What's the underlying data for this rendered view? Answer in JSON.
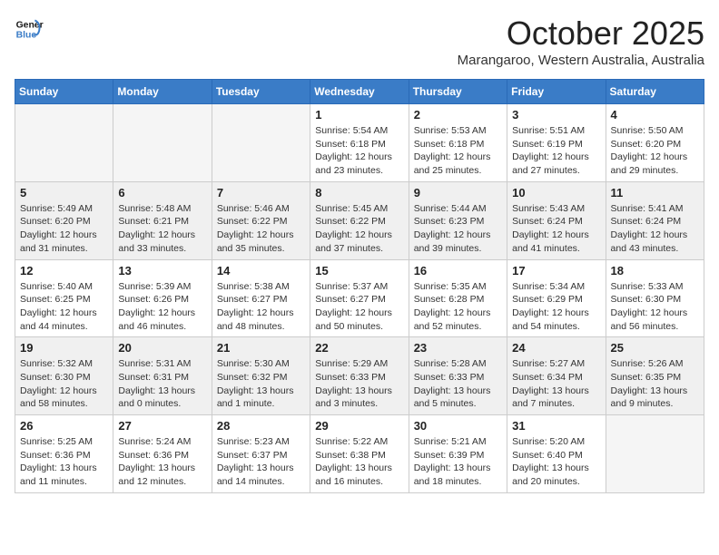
{
  "header": {
    "logo_line1": "General",
    "logo_line2": "Blue",
    "month": "October 2025",
    "location": "Marangaroo, Western Australia, Australia"
  },
  "weekdays": [
    "Sunday",
    "Monday",
    "Tuesday",
    "Wednesday",
    "Thursday",
    "Friday",
    "Saturday"
  ],
  "weeks": [
    [
      {
        "day": "",
        "info": ""
      },
      {
        "day": "",
        "info": ""
      },
      {
        "day": "",
        "info": ""
      },
      {
        "day": "1",
        "info": "Sunrise: 5:54 AM\nSunset: 6:18 PM\nDaylight: 12 hours\nand 23 minutes."
      },
      {
        "day": "2",
        "info": "Sunrise: 5:53 AM\nSunset: 6:18 PM\nDaylight: 12 hours\nand 25 minutes."
      },
      {
        "day": "3",
        "info": "Sunrise: 5:51 AM\nSunset: 6:19 PM\nDaylight: 12 hours\nand 27 minutes."
      },
      {
        "day": "4",
        "info": "Sunrise: 5:50 AM\nSunset: 6:20 PM\nDaylight: 12 hours\nand 29 minutes."
      }
    ],
    [
      {
        "day": "5",
        "info": "Sunrise: 5:49 AM\nSunset: 6:20 PM\nDaylight: 12 hours\nand 31 minutes."
      },
      {
        "day": "6",
        "info": "Sunrise: 5:48 AM\nSunset: 6:21 PM\nDaylight: 12 hours\nand 33 minutes."
      },
      {
        "day": "7",
        "info": "Sunrise: 5:46 AM\nSunset: 6:22 PM\nDaylight: 12 hours\nand 35 minutes."
      },
      {
        "day": "8",
        "info": "Sunrise: 5:45 AM\nSunset: 6:22 PM\nDaylight: 12 hours\nand 37 minutes."
      },
      {
        "day": "9",
        "info": "Sunrise: 5:44 AM\nSunset: 6:23 PM\nDaylight: 12 hours\nand 39 minutes."
      },
      {
        "day": "10",
        "info": "Sunrise: 5:43 AM\nSunset: 6:24 PM\nDaylight: 12 hours\nand 41 minutes."
      },
      {
        "day": "11",
        "info": "Sunrise: 5:41 AM\nSunset: 6:24 PM\nDaylight: 12 hours\nand 43 minutes."
      }
    ],
    [
      {
        "day": "12",
        "info": "Sunrise: 5:40 AM\nSunset: 6:25 PM\nDaylight: 12 hours\nand 44 minutes."
      },
      {
        "day": "13",
        "info": "Sunrise: 5:39 AM\nSunset: 6:26 PM\nDaylight: 12 hours\nand 46 minutes."
      },
      {
        "day": "14",
        "info": "Sunrise: 5:38 AM\nSunset: 6:27 PM\nDaylight: 12 hours\nand 48 minutes."
      },
      {
        "day": "15",
        "info": "Sunrise: 5:37 AM\nSunset: 6:27 PM\nDaylight: 12 hours\nand 50 minutes."
      },
      {
        "day": "16",
        "info": "Sunrise: 5:35 AM\nSunset: 6:28 PM\nDaylight: 12 hours\nand 52 minutes."
      },
      {
        "day": "17",
        "info": "Sunrise: 5:34 AM\nSunset: 6:29 PM\nDaylight: 12 hours\nand 54 minutes."
      },
      {
        "day": "18",
        "info": "Sunrise: 5:33 AM\nSunset: 6:30 PM\nDaylight: 12 hours\nand 56 minutes."
      }
    ],
    [
      {
        "day": "19",
        "info": "Sunrise: 5:32 AM\nSunset: 6:30 PM\nDaylight: 12 hours\nand 58 minutes."
      },
      {
        "day": "20",
        "info": "Sunrise: 5:31 AM\nSunset: 6:31 PM\nDaylight: 13 hours\nand 0 minutes."
      },
      {
        "day": "21",
        "info": "Sunrise: 5:30 AM\nSunset: 6:32 PM\nDaylight: 13 hours\nand 1 minute."
      },
      {
        "day": "22",
        "info": "Sunrise: 5:29 AM\nSunset: 6:33 PM\nDaylight: 13 hours\nand 3 minutes."
      },
      {
        "day": "23",
        "info": "Sunrise: 5:28 AM\nSunset: 6:33 PM\nDaylight: 13 hours\nand 5 minutes."
      },
      {
        "day": "24",
        "info": "Sunrise: 5:27 AM\nSunset: 6:34 PM\nDaylight: 13 hours\nand 7 minutes."
      },
      {
        "day": "25",
        "info": "Sunrise: 5:26 AM\nSunset: 6:35 PM\nDaylight: 13 hours\nand 9 minutes."
      }
    ],
    [
      {
        "day": "26",
        "info": "Sunrise: 5:25 AM\nSunset: 6:36 PM\nDaylight: 13 hours\nand 11 minutes."
      },
      {
        "day": "27",
        "info": "Sunrise: 5:24 AM\nSunset: 6:36 PM\nDaylight: 13 hours\nand 12 minutes."
      },
      {
        "day": "28",
        "info": "Sunrise: 5:23 AM\nSunset: 6:37 PM\nDaylight: 13 hours\nand 14 minutes."
      },
      {
        "day": "29",
        "info": "Sunrise: 5:22 AM\nSunset: 6:38 PM\nDaylight: 13 hours\nand 16 minutes."
      },
      {
        "day": "30",
        "info": "Sunrise: 5:21 AM\nSunset: 6:39 PM\nDaylight: 13 hours\nand 18 minutes."
      },
      {
        "day": "31",
        "info": "Sunrise: 5:20 AM\nSunset: 6:40 PM\nDaylight: 13 hours\nand 20 minutes."
      },
      {
        "day": "",
        "info": ""
      }
    ]
  ]
}
